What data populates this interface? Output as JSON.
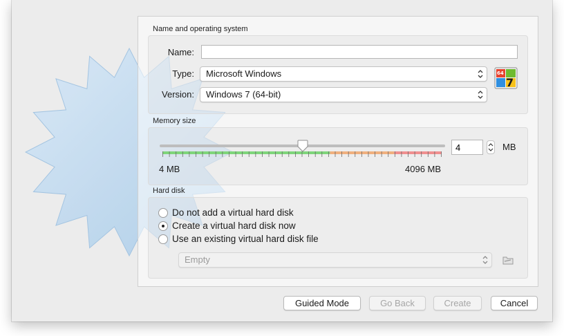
{
  "sections": {
    "name_os": "Name and operating system",
    "memory": "Memory size",
    "hard_disk": "Hard disk"
  },
  "name_field": {
    "label": "Name:",
    "value": ""
  },
  "type_field": {
    "label": "Type:",
    "value": "Microsoft Windows"
  },
  "version_field": {
    "label": "Version:",
    "value": "Windows 7 (64-bit)"
  },
  "os_icon": {
    "name": "windows-7-64bit-icon",
    "badge_top": "64",
    "badge_num": "7"
  },
  "memory": {
    "value": "4",
    "unit": "MB",
    "min_label": "4 MB",
    "max_label": "4096 MB",
    "slider_fraction": 0.5,
    "colors": {
      "ok": "#7ed57a",
      "warn": "#f0b07e",
      "bad": "#f08f8f"
    }
  },
  "hard_disk": {
    "options": [
      {
        "label": "Do not add a virtual hard disk",
        "selected": false
      },
      {
        "label": "Create a virtual hard disk now",
        "selected": true
      },
      {
        "label": "Use an existing virtual hard disk file",
        "selected": false
      }
    ],
    "file_select": "Empty"
  },
  "buttons": {
    "guided": "Guided Mode",
    "back": "Go Back",
    "create": "Create",
    "cancel": "Cancel"
  }
}
